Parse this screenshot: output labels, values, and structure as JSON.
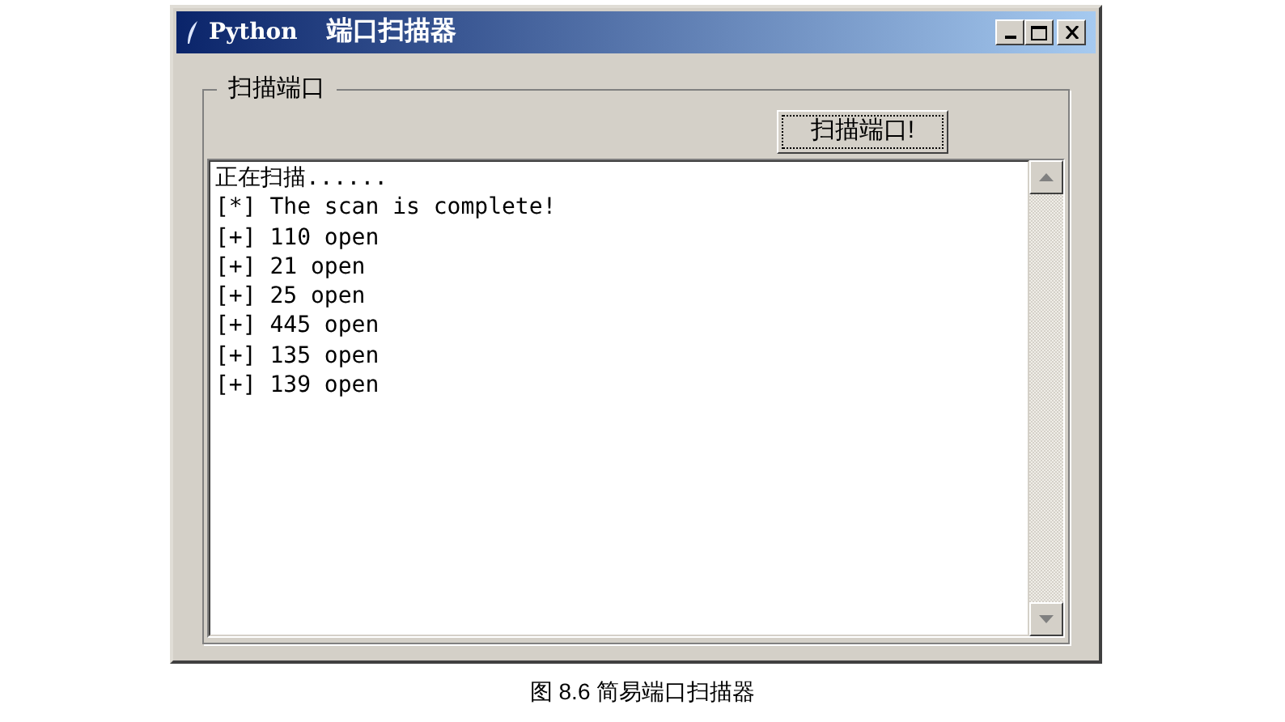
{
  "window": {
    "title_app": "Python",
    "title": "端口扫描器"
  },
  "group": {
    "label": "扫描端口",
    "button": "扫描端口!"
  },
  "output_lines": [
    "正在扫描......",
    "[*] The scan is complete!",
    "[+] 110 open",
    "[+] 21 open",
    "[+] 25 open",
    "[+] 445 open",
    "[+] 135 open",
    "[+] 139 open"
  ],
  "caption": "图 8.6 简易端口扫描器"
}
